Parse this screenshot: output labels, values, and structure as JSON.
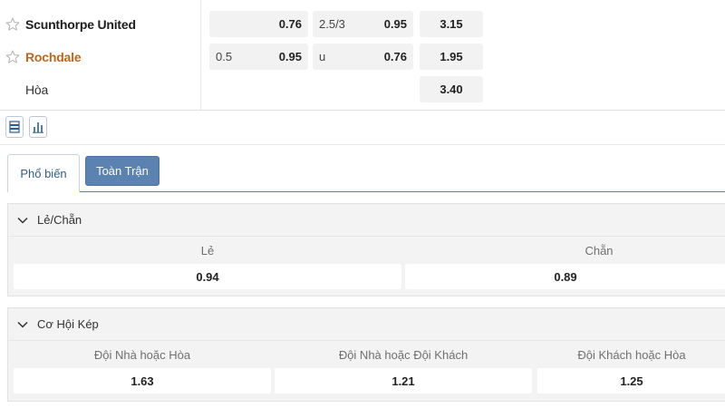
{
  "match": {
    "home_team": "Scunthorpe United",
    "away_team": "Rochdale",
    "draw_label": "Hòa",
    "handicap": {
      "home_line": "",
      "home_price": "0.76",
      "away_line": "0.5",
      "away_price": "0.95"
    },
    "over_under": {
      "over_line": "2.5/3",
      "over_price": "0.95",
      "under_line": "u",
      "under_price": "0.76"
    },
    "moneyline": {
      "home": "3.15",
      "away": "1.95",
      "draw": "3.40"
    }
  },
  "toolbar": {
    "icons": [
      "list-icon",
      "bar-chart-icon"
    ]
  },
  "tabs": [
    {
      "label": "Phổ biến",
      "active": true
    },
    {
      "label": "Toàn Trận",
      "active": false
    }
  ],
  "markets": [
    {
      "title": "Lẻ/Chẵn",
      "selections": [
        {
          "label": "Lẻ",
          "price": "0.94"
        },
        {
          "label": "Chẵn",
          "price": "0.89"
        }
      ]
    },
    {
      "title": "Cơ Hội Kép",
      "selections": [
        {
          "label": "Đội Nhà hoặc Hòa",
          "price": "1.63"
        },
        {
          "label": "Đội Nhà hoặc Đội Khách",
          "price": "1.21"
        },
        {
          "label": "Đội Khách hoặc Hòa",
          "price": "1.25"
        }
      ]
    }
  ],
  "colors": {
    "accent": "#5b82b0",
    "away_team": "#c0661d",
    "cell_bg": "#f2f2f2"
  }
}
